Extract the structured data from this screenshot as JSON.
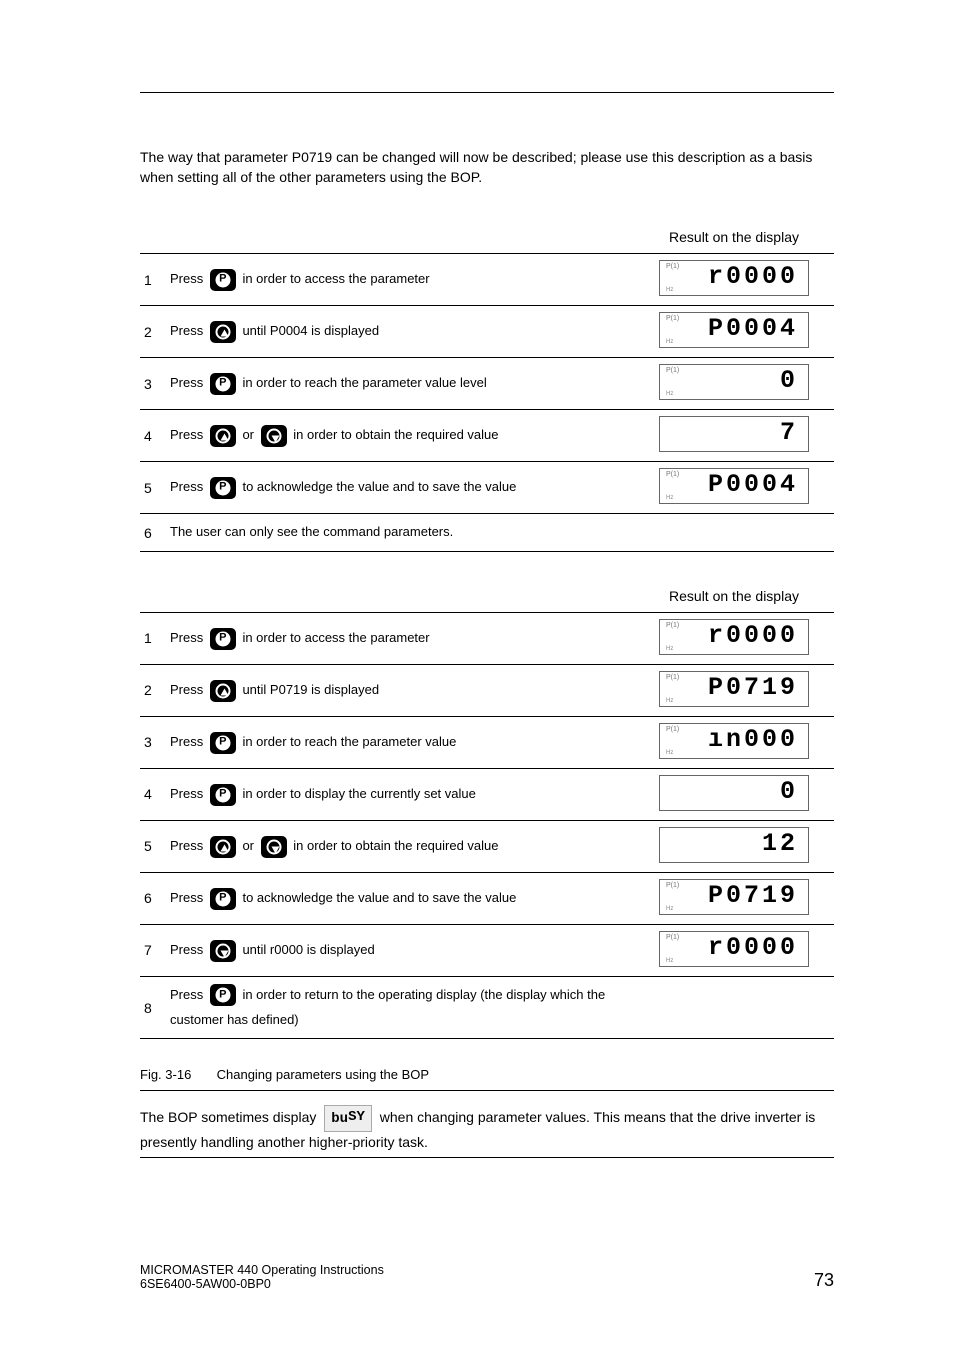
{
  "intro": "The way that parameter P0719 can be changed will now be described; please use this description as a basis when setting all of the other parameters using the BOP.",
  "table1": {
    "header_result": "Result on the display",
    "rows": [
      {
        "n": "1",
        "text_before": "Press ",
        "icons": [
          "p"
        ],
        "text_after": " in order to access the parameter",
        "disp": "r0000",
        "has_pi": true,
        "has_hz": true
      },
      {
        "n": "2",
        "text_before": "Press ",
        "icons": [
          "up"
        ],
        "text_after": " until P0004 is displayed",
        "disp": "P0004",
        "has_pi": true,
        "has_hz": true
      },
      {
        "n": "3",
        "text_before": "Press ",
        "icons": [
          "p"
        ],
        "text_after": " in order to reach the parameter value level",
        "disp": "0",
        "has_pi": true,
        "has_hz": true
      },
      {
        "n": "4",
        "text_before": "Press ",
        "icons": [
          "up"
        ],
        "text_mid": " or ",
        "icons2": [
          "down"
        ],
        "text_after": "  in order to obtain the required value",
        "disp": "7",
        "has_pi": false,
        "has_hz": false
      },
      {
        "n": "5",
        "text_before": "Press ",
        "icons": [
          "p"
        ],
        "text_after": " to acknowledge the value and to save the value",
        "disp": "P0004",
        "has_pi": true,
        "has_hz": true
      },
      {
        "n": "6",
        "text_before": "",
        "icons": [],
        "text_after": "The user can only see the command parameters.",
        "disp": null
      }
    ]
  },
  "table2": {
    "header_result": "Result on the display",
    "rows": [
      {
        "n": "1",
        "text_before": "Press ",
        "icons": [
          "p"
        ],
        "text_after": " in order to access the parameter",
        "disp": "r0000",
        "has_pi": true,
        "has_hz": true
      },
      {
        "n": "2",
        "text_before": "Press ",
        "icons": [
          "up"
        ],
        "text_after": " until P0719 is displayed",
        "disp": "P0719",
        "has_pi": true,
        "has_hz": true
      },
      {
        "n": "3",
        "text_before": "Press ",
        "icons": [
          "p"
        ],
        "text_after": " in order to reach the parameter value",
        "disp": "ın000",
        "has_pi": true,
        "has_hz": true
      },
      {
        "n": "4",
        "text_before": "Press ",
        "icons": [
          "p"
        ],
        "text_after": " in order to display the currently set value",
        "disp": "0",
        "has_pi": false,
        "has_hz": false
      },
      {
        "n": "5",
        "text_before": "Press ",
        "icons": [
          "up"
        ],
        "text_mid": " or ",
        "icons2": [
          "down"
        ],
        "text_after": " in order to obtain the required value",
        "disp": "12",
        "has_pi": false,
        "has_hz": false
      },
      {
        "n": "6",
        "text_before": "Press ",
        "icons": [
          "p"
        ],
        "text_after": " to acknowledge the value and to save the value",
        "disp": "P0719",
        "has_pi": true,
        "has_hz": true
      },
      {
        "n": "7",
        "text_before": "Press ",
        "icons": [
          "down"
        ],
        "text_after": " until r0000 is displayed",
        "disp": "r0000",
        "has_pi": true,
        "has_hz": true
      },
      {
        "n": "8",
        "text_before": "Press ",
        "icons": [
          "p"
        ],
        "text_after": " in order to return to the operating display (the display which the customer has defined)",
        "disp": null
      }
    ]
  },
  "fig_label_prefix": "Fig. 3-16",
  "fig_label_text": "Changing parameters using the BOP",
  "note_a": "The BOP sometimes display ",
  "busy": "buSY",
  "note_b": " when changing parameter values. This means that the drive inverter is presently handling another higher-priority task.",
  "footer_a": "MICROMASTER 440     Operating Instructions",
  "footer_b": "6SE6400-5AW00-0BP0",
  "page_num": "73",
  "pi_text": "P(1)",
  "hz_text": "Hz"
}
